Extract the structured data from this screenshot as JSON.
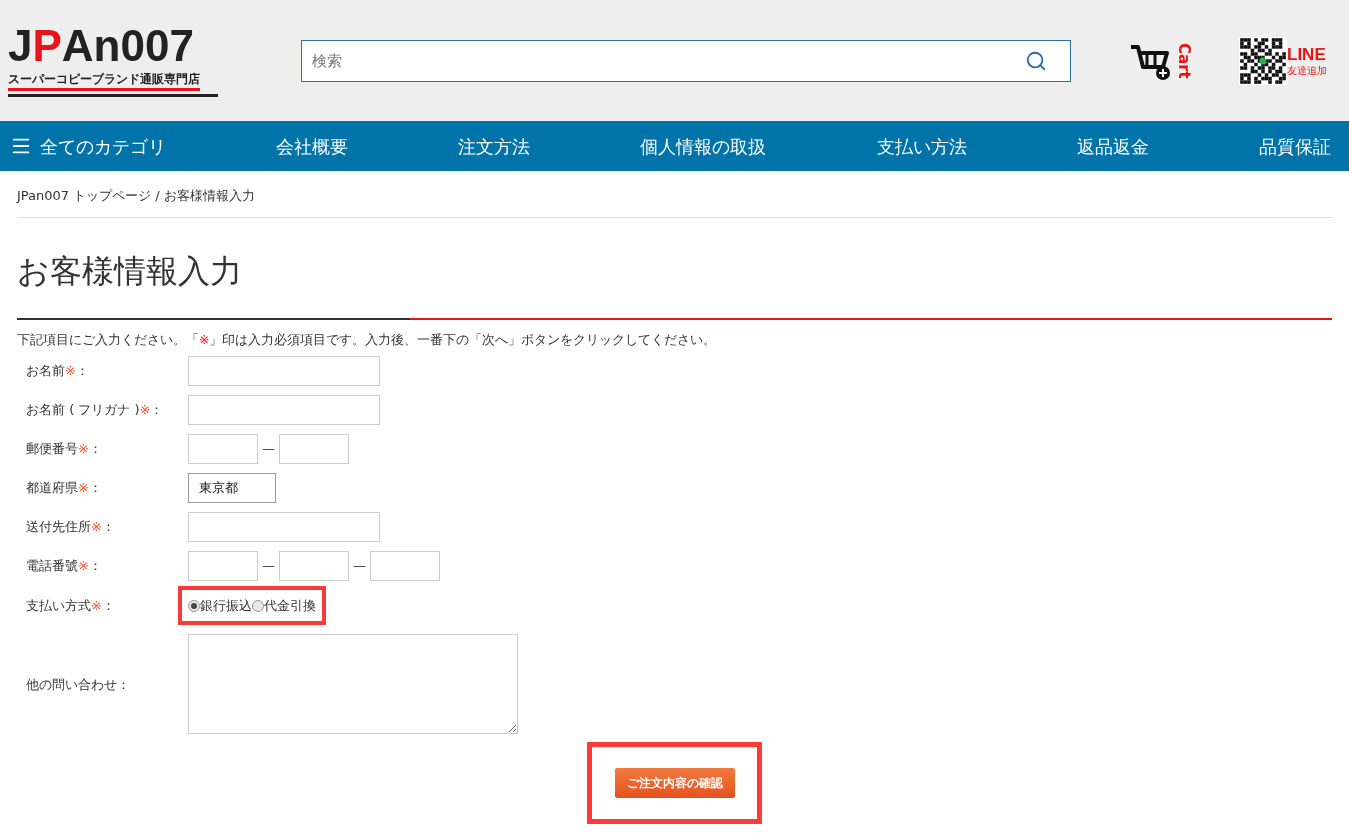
{
  "header": {
    "logo": {
      "letters": [
        {
          "text": "J",
          "color": "#222222"
        },
        {
          "text": "P",
          "color": "#e8141b"
        },
        {
          "text": "An007",
          "color": "#222222"
        }
      ],
      "tagline": "スーパーコピーブランド通販専門店"
    },
    "search": {
      "placeholder": "検索"
    },
    "cart": {
      "label": "Cart"
    },
    "line": {
      "label": "LINE",
      "sub": "友達追加"
    }
  },
  "nav": [
    {
      "label": "全てのカテゴリ",
      "kind": "menu"
    },
    {
      "label": "会社概要",
      "kind": "link"
    },
    {
      "label": "注文方法",
      "kind": "link"
    },
    {
      "label": "個人情報の取扱",
      "kind": "link"
    },
    {
      "label": "支払い方法",
      "kind": "link"
    },
    {
      "label": "返品返金",
      "kind": "link"
    },
    {
      "label": "品質保証",
      "kind": "link"
    }
  ],
  "breadcrumb": [
    {
      "label": "JPan007 トップページ"
    },
    {
      "label": "/"
    },
    {
      "label": "お客様情報入力"
    }
  ],
  "title": "お客様情報入力",
  "instruction": {
    "before": "下記項目にご入力ください。「",
    "mark": "※",
    "after": "」印は入力必須項目です。入力後、一番下の「次へ」ボタンをクリックしてください。"
  },
  "form": [
    {
      "label": "お名前",
      "required_mark": "※",
      "suffix": "：",
      "kind": "text",
      "fields": [
        {
          "kind": "wide"
        }
      ]
    },
    {
      "label": "お名前 ( フリガナ )",
      "required_mark": "※",
      "suffix": "：",
      "kind": "text",
      "fields": [
        {
          "kind": "wide"
        }
      ]
    },
    {
      "label": "郵便番号",
      "required_mark": "※",
      "suffix": "：",
      "kind": "text",
      "separator": "—",
      "fields": [
        {
          "kind": "short"
        },
        {
          "kind": "short"
        }
      ]
    },
    {
      "label": "都道府県",
      "required_mark": "※",
      "suffix": "：",
      "kind": "select",
      "value": "東京都"
    },
    {
      "label": "送付先住所",
      "required_mark": "※",
      "suffix": "：",
      "kind": "text",
      "fields": [
        {
          "kind": "wide"
        }
      ]
    },
    {
      "label": "電話番號",
      "required_mark": "※",
      "suffix": "：",
      "kind": "text",
      "separator": "—",
      "fields": [
        {
          "kind": "short"
        },
        {
          "kind": "short"
        },
        {
          "kind": "short"
        }
      ]
    },
    {
      "label": "支払い方式",
      "required_mark": "※",
      "suffix": "：",
      "kind": "radio",
      "highlighted": true,
      "options": [
        {
          "label": "銀行振込",
          "selected": true
        },
        {
          "label": "代金引換",
          "selected": false
        }
      ]
    },
    {
      "label": "他の問い合わせ",
      "suffix": "：",
      "kind": "textarea"
    }
  ],
  "submit": {
    "label": "ご注文内容の確認",
    "highlighted": true
  }
}
